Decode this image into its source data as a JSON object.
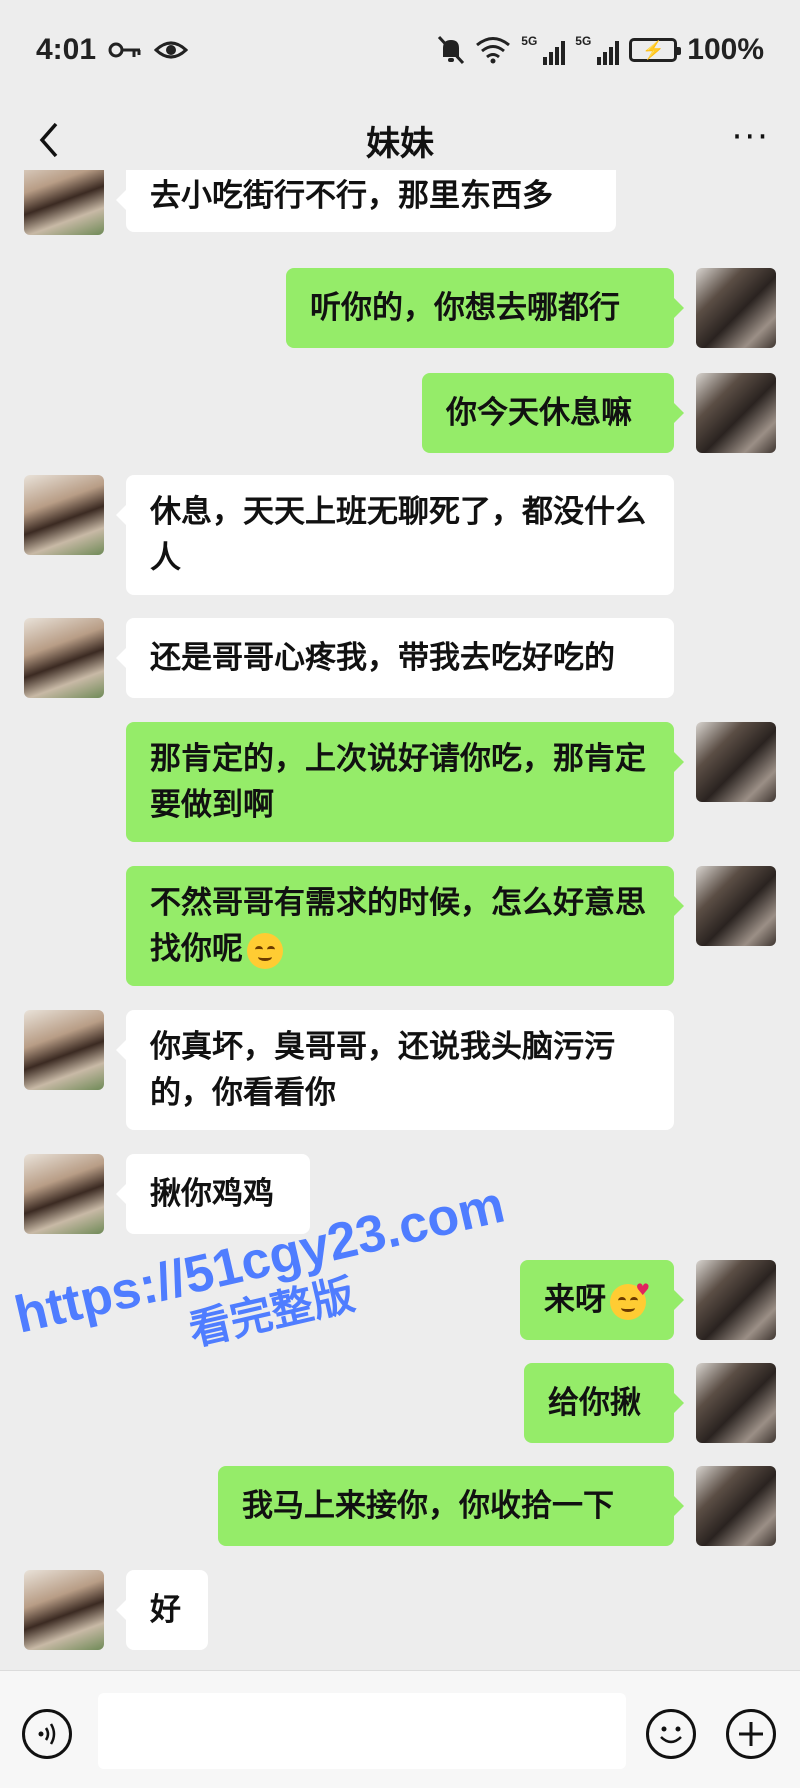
{
  "status_bar": {
    "time": "4:01",
    "signal_1": "5G",
    "signal_2": "5G",
    "battery_percent": "100%"
  },
  "header": {
    "title": "妹妹",
    "more_label": "···"
  },
  "messages": [
    {
      "from": "her",
      "text": "去小吃街行不行，那里东西多"
    },
    {
      "from": "me",
      "text": "听你的，你想去哪都行"
    },
    {
      "from": "me",
      "text": "你今天休息嘛"
    },
    {
      "from": "her",
      "text": "休息，天天上班无聊死了，都没什么人"
    },
    {
      "from": "her",
      "text": "还是哥哥心疼我，带我去吃好吃的"
    },
    {
      "from": "me",
      "text": "那肯定的，上次说好请你吃，那肯定要做到啊"
    },
    {
      "from": "me",
      "text": "不然哥哥有需求的时候，怎么好意思找你呢",
      "emoji": "smirk-emoji"
    },
    {
      "from": "her",
      "text": "你真坏，臭哥哥，还说我头脑污污的，你看看你"
    },
    {
      "from": "her",
      "text": "揪你鸡鸡"
    },
    {
      "from": "me",
      "text": "来呀",
      "emoji": "kiss-emoji"
    },
    {
      "from": "me",
      "text": "给你揪"
    },
    {
      "from": "me",
      "text": "我马上来接你，你收拾一下"
    },
    {
      "from": "her",
      "text": "好"
    }
  ],
  "watermark": {
    "url": "https://51cgy23.com",
    "subtitle": "看完整版"
  },
  "colors": {
    "background": "#ededed",
    "my_bubble": "#95ec69",
    "her_bubble": "#ffffff",
    "watermark": "#4f7dff"
  },
  "icons": {
    "back": "chevron-left-icon",
    "more": "more-dots-icon",
    "key": "key-icon",
    "eye": "eye-icon",
    "mute": "bell-off-icon",
    "wifi": "wifi-icon",
    "battery": "battery-charging-icon",
    "voice": "voice-icon",
    "emoji": "emoji-icon",
    "plus": "plus-icon"
  }
}
